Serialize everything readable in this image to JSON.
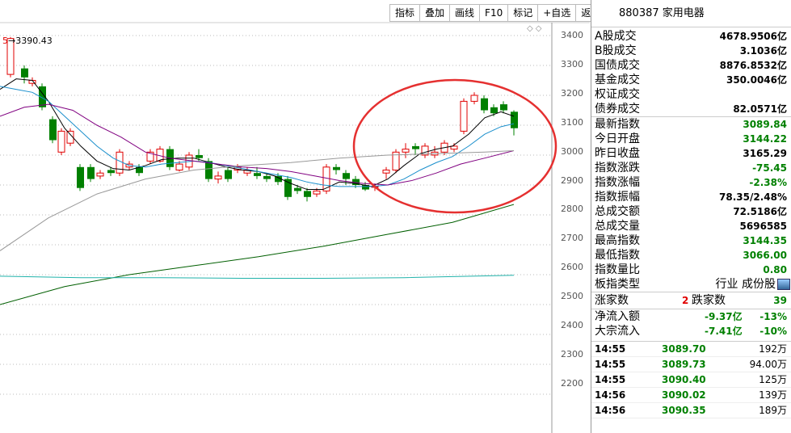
{
  "toolbar": {
    "items": [
      "指标",
      "叠加",
      "画线",
      "F10",
      "标记",
      "+自选",
      "返回"
    ]
  },
  "chart": {
    "high_label": "3390.43",
    "y_ticks": [
      "3400",
      "3300",
      "3200",
      "3100",
      "3000",
      "2900",
      "2800",
      "2700",
      "2600",
      "2500",
      "2400",
      "2300",
      "2200"
    ],
    "up_color": "#e00000",
    "down_color": "#008000",
    "annotation_color": "#e53030"
  },
  "header": {
    "code": "880387",
    "name": "家用电器"
  },
  "stats": [
    {
      "label": "A股成交",
      "value": "4678.9506亿",
      "color": "black"
    },
    {
      "label": "B股成交",
      "value": "3.1036亿",
      "color": "black"
    },
    {
      "label": "国债成交",
      "value": "8876.8532亿",
      "color": "black"
    },
    {
      "label": "基金成交",
      "value": "350.0046亿",
      "color": "black"
    },
    {
      "label": "权证成交",
      "value": "",
      "color": "black"
    },
    {
      "label": "债券成交",
      "value": "82.0571亿",
      "color": "black"
    }
  ],
  "index_info": [
    {
      "label": "最新指数",
      "value": "3089.84",
      "color": "green"
    },
    {
      "label": "今日开盘",
      "value": "3144.22",
      "color": "green"
    },
    {
      "label": "昨日收盘",
      "value": "3165.29",
      "color": "black"
    },
    {
      "label": "指数涨跌",
      "value": "-75.45",
      "color": "green"
    },
    {
      "label": "指数涨幅",
      "value": "-2.38%",
      "color": "green"
    },
    {
      "label": "指数振幅",
      "value": "78.35/2.48%",
      "color": "black"
    },
    {
      "label": "总成交额",
      "value": "72.5186亿",
      "color": "black"
    },
    {
      "label": "总成交量",
      "value": "5696585",
      "color": "black"
    },
    {
      "label": "最高指数",
      "value": "3144.35",
      "color": "green"
    },
    {
      "label": "最低指数",
      "value": "3066.00",
      "color": "green"
    },
    {
      "label": "指数量比",
      "value": "0.80",
      "color": "green"
    }
  ],
  "board_type": {
    "label": "板指类型",
    "value": "行业 成份股"
  },
  "breadth": {
    "up_label": "涨家数",
    "up_value": "2",
    "down_label": "跌家数",
    "down_value": "39"
  },
  "flows": [
    {
      "label": "净流入额",
      "value": "-9.37亿",
      "pct": "-13%"
    },
    {
      "label": "大宗流入",
      "value": "-7.41亿",
      "pct": "-10%"
    }
  ],
  "ticks": [
    {
      "time": "14:55",
      "price": "3089.70",
      "vol": "192万"
    },
    {
      "time": "14:55",
      "price": "3089.73",
      "vol": "94.00万"
    },
    {
      "time": "14:55",
      "price": "3090.40",
      "vol": "125万"
    },
    {
      "time": "14:56",
      "price": "3090.02",
      "vol": "139万"
    },
    {
      "time": "14:56",
      "price": "3090.35",
      "vol": "189万"
    }
  ]
}
